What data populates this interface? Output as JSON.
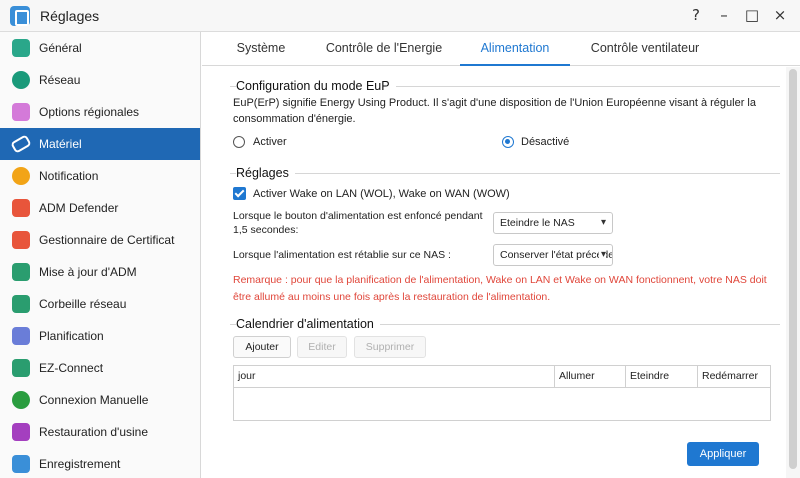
{
  "window": {
    "title": "Réglages",
    "controls": [
      "?",
      "–",
      "□",
      "×"
    ]
  },
  "sidebar": {
    "items": [
      {
        "label": "Général",
        "icon": "general-icon",
        "color": "#2aa78a"
      },
      {
        "label": "Réseau",
        "icon": "globe-icon",
        "color": "#1a9a7a"
      },
      {
        "label": "Options régionales",
        "icon": "location-pin-icon",
        "color": "#d47ad9"
      },
      {
        "label": "Matériel",
        "icon": "hardware-icon",
        "color": "#ffffff"
      },
      {
        "label": "Notification",
        "icon": "alert-icon",
        "color": "#f2a417"
      },
      {
        "label": "ADM Defender",
        "icon": "firewall-icon",
        "color": "#e8553b"
      },
      {
        "label": "Gestionnaire de Certificat",
        "icon": "certificate-icon",
        "color": "#e8553b"
      },
      {
        "label": "Mise à jour d'ADM",
        "icon": "upload-icon",
        "color": "#2a9d6f"
      },
      {
        "label": "Corbeille réseau",
        "icon": "recycle-bin-icon",
        "color": "#2a9d6f"
      },
      {
        "label": "Planification",
        "icon": "calendar-icon",
        "color": "#6a7dd8"
      },
      {
        "label": "EZ-Connect",
        "icon": "cloud-icon",
        "color": "#2a9d6f"
      },
      {
        "label": "Connexion Manuelle",
        "icon": "network-globe-icon",
        "color": "#2a9d3f"
      },
      {
        "label": "Restauration d'usine",
        "icon": "undo-icon",
        "color": "#a43fbf"
      },
      {
        "label": "Enregistrement",
        "icon": "register-icon",
        "color": "#3a8fd8"
      }
    ],
    "active_index": 3
  },
  "tabs": [
    {
      "label": "Système"
    },
    {
      "label": "Contrôle de l'Energie"
    },
    {
      "label": "Alimentation"
    },
    {
      "label": "Contrôle ventilateur"
    }
  ],
  "eup": {
    "title": "Configuration du mode EuP",
    "description": "EuP(ErP) signifie Energy Using Product. Il s'agit d'une disposition de l'Union Européenne visant à réguler la consommation d'énergie.",
    "option_on": "Activer",
    "option_off": "Désactivé",
    "selected": "off"
  },
  "settings": {
    "title": "Réglages",
    "wol_label": "Activer Wake on LAN (WOL), Wake on WAN  (WOW)",
    "wol_checked": true,
    "power_button_label": "Lorsque le bouton d'alimentation est enfoncé pendant 1,5 secondes:",
    "power_button_value": "Eteindre le NAS",
    "power_restore_label": "Lorsque l'alimentation est rétablie sur ce NAS :",
    "power_restore_value": "Conserver l'état précédent",
    "remark": "Remarque : pour que la planification de l'alimentation, Wake on LAN et Wake on WAN fonctionnent, votre NAS doit être allumé au moins une fois après la restauration de l'alimentation."
  },
  "schedule": {
    "title": "Calendrier d'alimentation",
    "add_label": "Ajouter",
    "edit_label": "Editer",
    "delete_label": "Supprimer",
    "columns": [
      "jour",
      "Allumer",
      "Eteindre",
      "Redémarrer"
    ]
  },
  "apply_label": "Appliquer",
  "colors": {
    "accent": "#1f78d1",
    "sidebar_active": "#1f68b4",
    "remark": "#e0463a"
  }
}
